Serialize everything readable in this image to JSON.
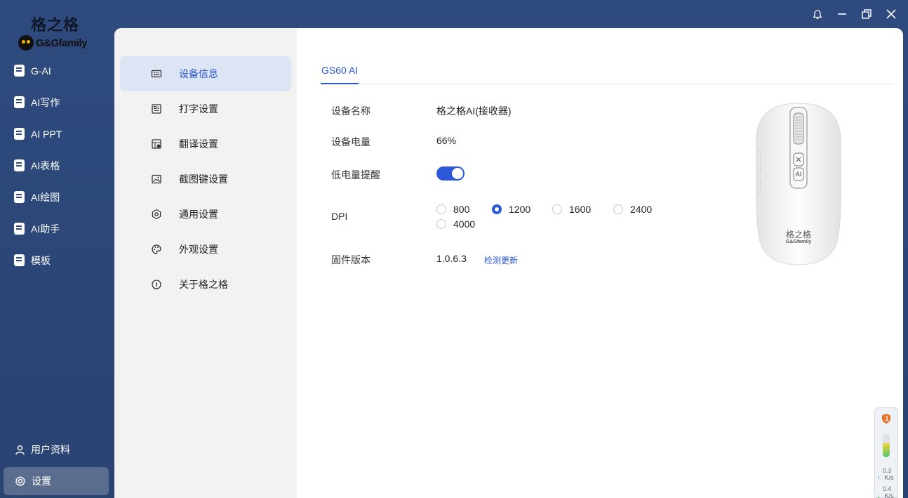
{
  "brand": {
    "name_cn": "格之格",
    "name_en": "G&Gfamily"
  },
  "nav": [
    {
      "label": "G-AI",
      "icon": "g-ai-icon"
    },
    {
      "label": "AI写作",
      "icon": "writing-icon"
    },
    {
      "label": "AI PPT",
      "icon": "ppt-icon"
    },
    {
      "label": "AI表格",
      "icon": "table-icon"
    },
    {
      "label": "AI绘图",
      "icon": "drawing-icon"
    },
    {
      "label": "AI助手",
      "icon": "assistant-icon"
    },
    {
      "label": "模板",
      "icon": "template-icon"
    }
  ],
  "bottom_nav": {
    "profile": "用户资料",
    "settings": "设置"
  },
  "submenu": [
    {
      "label": "设备信息",
      "icon": "device-info-icon",
      "active": true
    },
    {
      "label": "打字设置",
      "icon": "typing-icon"
    },
    {
      "label": "翻译设置",
      "icon": "translate-icon"
    },
    {
      "label": "截图键设置",
      "icon": "screenshot-icon"
    },
    {
      "label": "通用设置",
      "icon": "general-settings-icon"
    },
    {
      "label": "外观设置",
      "icon": "palette-icon"
    },
    {
      "label": "关于格之格",
      "icon": "info-icon"
    }
  ],
  "tab": {
    "label": "GS60 AI"
  },
  "device": {
    "name_label": "设备名称",
    "name_value": "格之格AI(接收器)",
    "battery_label": "设备电量",
    "battery_value": "66%",
    "low_battery_label": "低电量提醒",
    "low_battery_on": true,
    "dpi_label": "DPI",
    "dpi_options": [
      "800",
      "1200",
      "1600",
      "2400",
      "4000"
    ],
    "dpi_selected": "1200",
    "firmware_label": "固件版本",
    "firmware_value": "1.0.6.3",
    "update_link": "检测更新"
  },
  "mouse_image": {
    "brand_cn": "格之格",
    "brand_en": "G&Gfamily",
    "button_label": "AI"
  },
  "widget": {
    "badge": "1",
    "up_value": "0.3",
    "up_unit": "K/s",
    "down_value": "0.4",
    "down_unit": "K/s"
  },
  "colors": {
    "accent": "#2b58d8",
    "sidebar": "#2f4a7e",
    "submenu_bg": "#f2f2f2",
    "active_bg": "#dde5f4"
  }
}
